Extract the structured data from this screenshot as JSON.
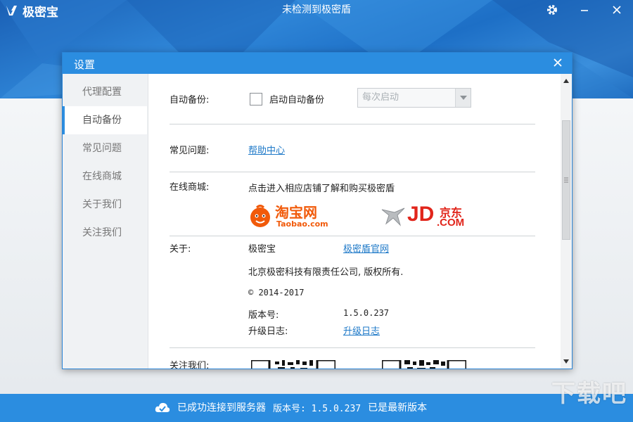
{
  "app": {
    "name": "极密宝",
    "status_title": "未检测到极密盾"
  },
  "dialog": {
    "title": "设置"
  },
  "sidebar": {
    "items": [
      {
        "label": "代理配置"
      },
      {
        "label": "自动备份"
      },
      {
        "label": "常见问题"
      },
      {
        "label": "在线商城"
      },
      {
        "label": "关于我们"
      },
      {
        "label": "关注我们"
      }
    ],
    "active_index": 1
  },
  "auto_backup": {
    "label": "自动备份:",
    "checkbox_label": "启动自动备份",
    "checked": false,
    "select_value": "每次启动"
  },
  "faq": {
    "label": "常见问题:",
    "link": "帮助中心"
  },
  "shop": {
    "label": "在线商城:",
    "description": "点击进入相应店铺了解和购买极密盾",
    "taobao_logo_text": "淘宝网",
    "taobao_logo_sub": "Taobao.com",
    "jd_logo_text": "JD",
    "jd_logo_cn": "京东",
    "jd_logo_sub": ".COM"
  },
  "about": {
    "label": "关于:",
    "product": "极密宝",
    "official_site_link": "极密盾官网",
    "company": "北京极密科技有限责任公司, 版权所有.",
    "copyright": "© 2014-2017",
    "version_label": "版本号:",
    "version_value": "1.5.0.237",
    "changelog_label": "升级日志:",
    "changelog_link": "升级日志"
  },
  "follow": {
    "label": "关注我们:"
  },
  "status_bar": {
    "connected": "已成功连接到服务器",
    "version_text": "版本号: 1.5.0.237",
    "latest": "已是最新版本"
  },
  "watermark": "下载吧",
  "colors": {
    "accent": "#2b8de0",
    "link": "#1e79c8",
    "taobao_orange": "#f15a0a",
    "jd_red": "#e1251b"
  }
}
